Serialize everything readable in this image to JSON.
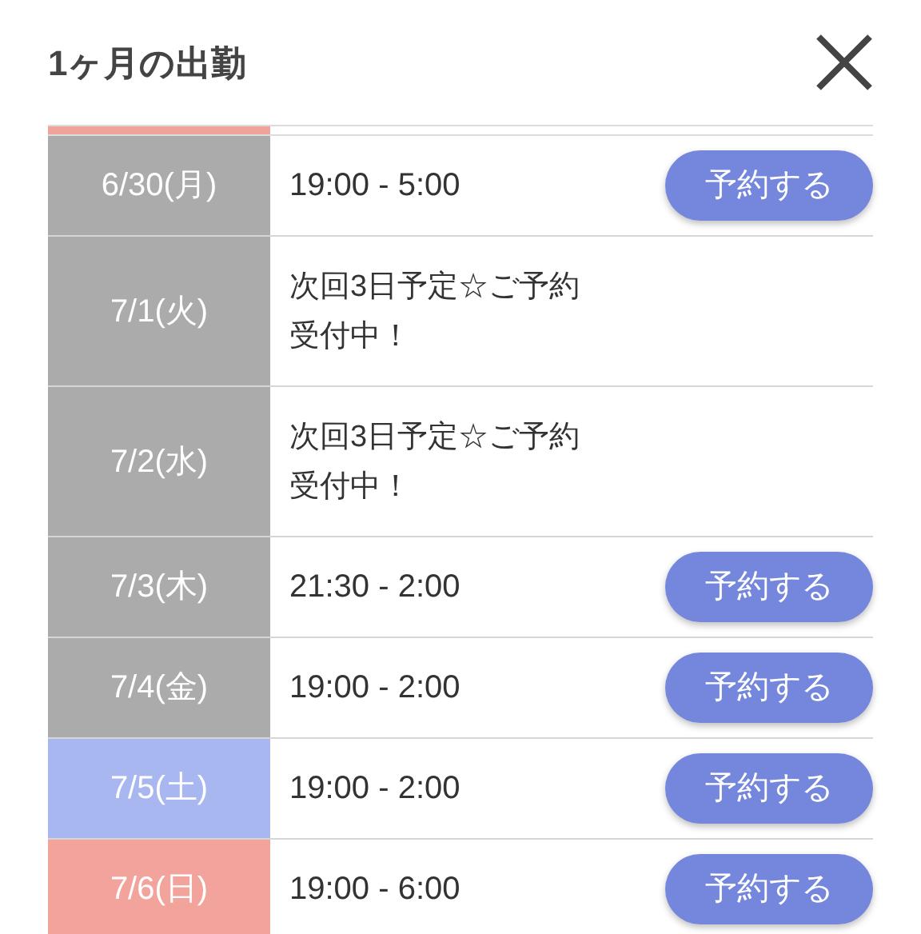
{
  "header": {
    "title": "1ヶ月の出勤"
  },
  "rows": [
    {
      "kind": "cut",
      "color": "#f0a39b"
    },
    {
      "kind": "time",
      "date": "6/30(月)",
      "color": "#ababab",
      "text": "19:00 - 5:00",
      "button": "予約する"
    },
    {
      "kind": "note",
      "date": "7/1(火)",
      "color": "#ababab",
      "text": "次回3日予定☆ご予約受付中！"
    },
    {
      "kind": "note",
      "date": "7/2(水)",
      "color": "#ababab",
      "text": "次回3日予定☆ご予約受付中！"
    },
    {
      "kind": "time",
      "date": "7/3(木)",
      "color": "#ababab",
      "text": "21:30 - 2:00",
      "button": "予約する"
    },
    {
      "kind": "time",
      "date": "7/4(金)",
      "color": "#ababab",
      "text": "19:00 - 2:00",
      "button": "予約する"
    },
    {
      "kind": "time",
      "date": "7/5(土)",
      "color": "#a8b7f0",
      "text": "19:00 - 2:00",
      "button": "予約する"
    },
    {
      "kind": "time",
      "date": "7/6(日)",
      "color": "#f2a39b",
      "text": "19:00 - 6:00",
      "button": "予約する"
    }
  ]
}
